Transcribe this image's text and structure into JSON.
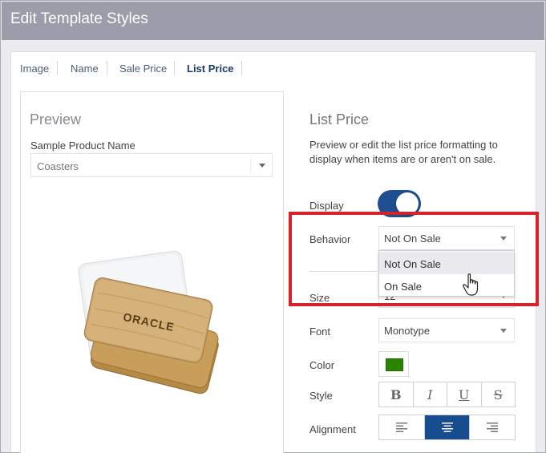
{
  "window": {
    "title": "Edit Template Styles"
  },
  "tabs": [
    {
      "label": "Image",
      "active": false
    },
    {
      "label": "Name",
      "active": false
    },
    {
      "label": "Sale Price",
      "active": false
    },
    {
      "label": "List Price",
      "active": true
    }
  ],
  "preview": {
    "heading": "Preview",
    "sample_label": "Sample Product Name",
    "sample_value": "Coasters",
    "logo_text": "ORACLE"
  },
  "list_price": {
    "heading": "List Price",
    "description": "Preview or edit the list price formatting to display when items are or aren't on sale.",
    "display_label": "Display",
    "display_on": true,
    "behavior_label": "Behavior",
    "behavior_value": "Not On Sale",
    "behavior_options": [
      "Not On Sale",
      "On Sale"
    ],
    "size_label": "Size",
    "size_value": "12",
    "font_label": "Font",
    "font_value": "Monotype",
    "color_label": "Color",
    "color_value": "#2a8400",
    "style_label": "Style",
    "style_buttons": [
      "B",
      "I",
      "U",
      "S"
    ],
    "alignment_label": "Alignment",
    "alignment_buttons": [
      "align-left-icon",
      "align-center-icon",
      "align-right-icon"
    ],
    "alignment_selected": "center"
  }
}
